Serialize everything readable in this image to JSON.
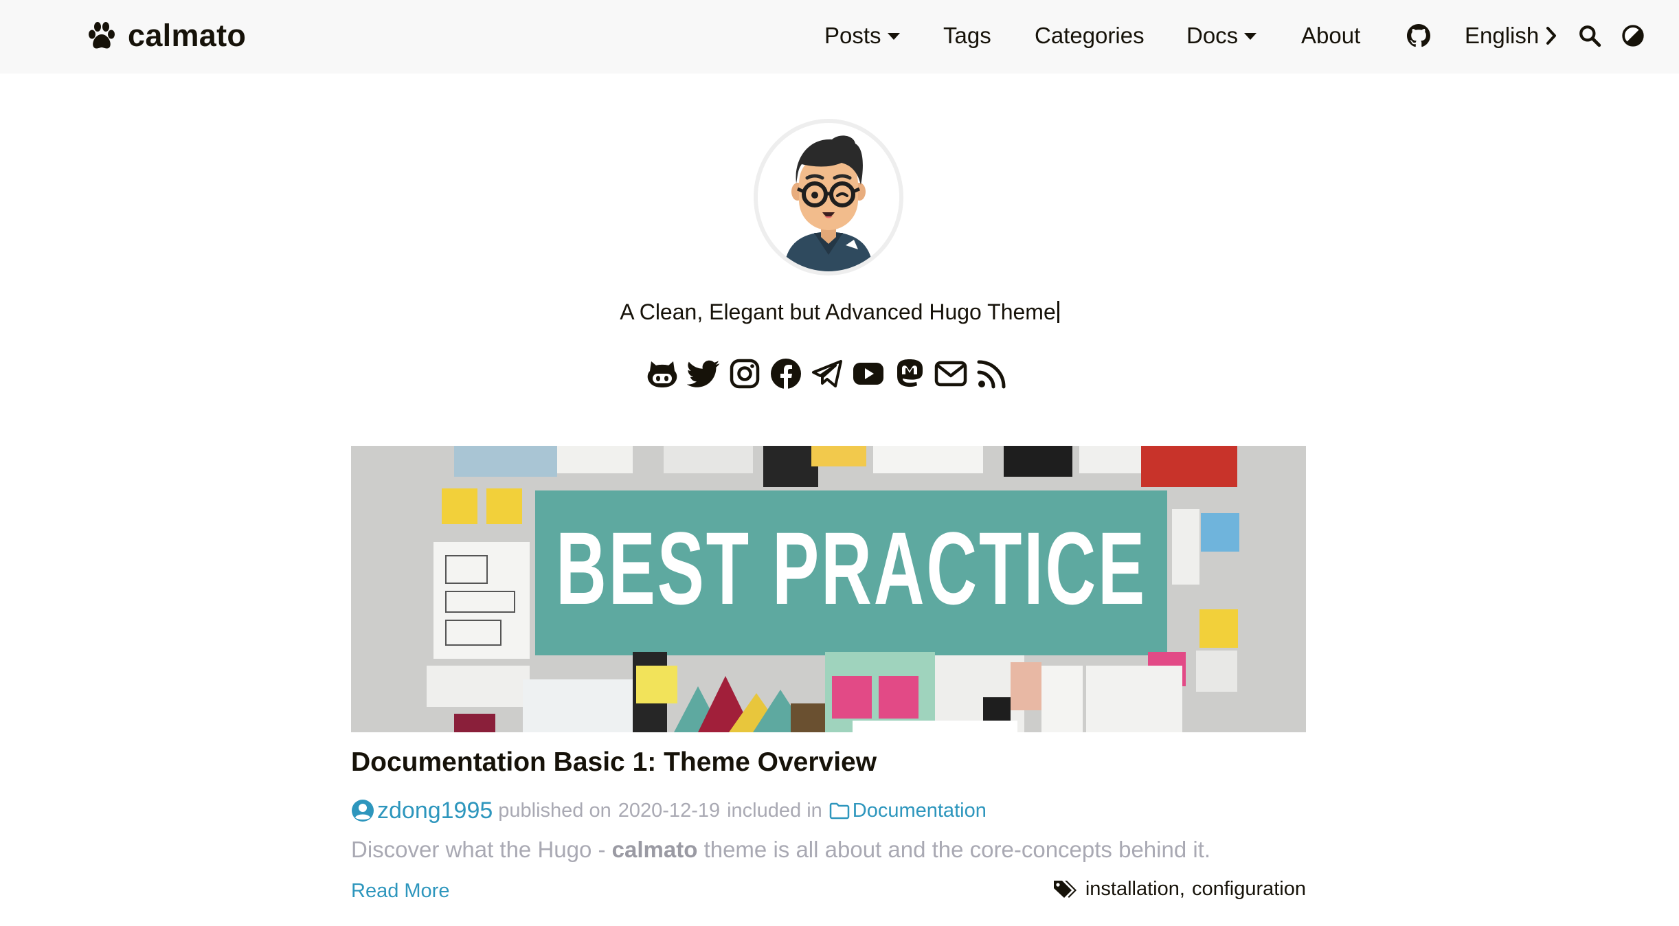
{
  "header": {
    "logo_text": "calmato",
    "nav": {
      "posts": "Posts",
      "tags": "Tags",
      "categories": "Categories",
      "docs": "Docs",
      "about": "About",
      "language": "English"
    },
    "icons": [
      "paw-icon",
      "github-icon",
      "chevron-right-icon",
      "search-icon",
      "theme-switch-icon"
    ]
  },
  "profile": {
    "subtitle": "A Clean, Elegant but Advanced Hugo Theme",
    "social_icons": [
      "github-icon",
      "twitter-icon",
      "instagram-icon",
      "facebook-icon",
      "telegram-icon",
      "youtube-icon",
      "mastodon-icon",
      "email-icon",
      "rss-icon"
    ]
  },
  "post": {
    "featured_text": "BEST PRACTICE",
    "title": "Documentation Basic 1: Theme Overview",
    "author": "zdong1995",
    "published_prefix": "published on",
    "date": "2020-12-19",
    "included_prefix": "included in",
    "category": "Documentation",
    "summary_before": "Discover what the Hugo -",
    "summary_bold": "calmato",
    "summary_after": "theme is all about and the core-concepts behind it.",
    "read_more": "Read More",
    "tags": [
      "installation",
      "configuration"
    ],
    "tag_separator": ","
  },
  "colors": {
    "accent": "#2d96bd",
    "text": "#161209",
    "muted": "#a9a9b3",
    "header_bg": "#f8f8f8",
    "banner": "#5ea9a0"
  }
}
